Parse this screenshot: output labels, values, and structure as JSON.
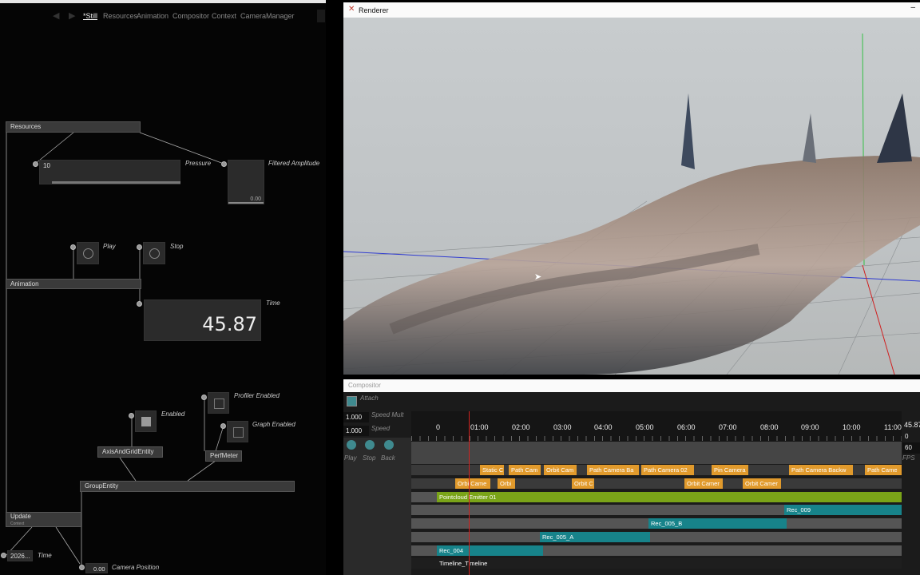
{
  "editor": {
    "tabs": [
      "*Still",
      "Resources",
      "Animation",
      "Compositor",
      "Context",
      "CameraManager"
    ],
    "nodes": {
      "resources": "Resources",
      "animation": "Animation",
      "axis": "AxisAndGridEntity",
      "perfmeter": "PerfMeter",
      "group": "GroupEntity",
      "update": "Update",
      "update_sub": "Context"
    },
    "pressure": {
      "value": "10",
      "label": "Pressure"
    },
    "filtered": {
      "value": "0.00",
      "label": "Filtered Amplitude"
    },
    "play_label": "Play",
    "stop_label": "Stop",
    "time": {
      "value": "45.87",
      "label": "Time"
    },
    "enabled_label": "Enabled",
    "profiler_label": "Profiler Enabled",
    "graph_label": "Graph Enabled",
    "update_time": {
      "value": "2026...",
      "label": "Time"
    },
    "camera_position": {
      "value": "0.00",
      "label": "Camera Position"
    }
  },
  "renderer": {
    "title": "Renderer",
    "minimize": "–"
  },
  "compositor": {
    "title": "Compositor",
    "attach_label": "Attach",
    "speed_mult": {
      "value": "1.000",
      "label": "Speed Mult"
    },
    "speed": {
      "value": "1.000",
      "label": "Speed"
    },
    "buttons": [
      "Play",
      "Stop",
      "Back"
    ],
    "ticks": [
      "0",
      "01:00",
      "02:00",
      "03:00",
      "04:00",
      "05:00",
      "06:00",
      "07:00",
      "08:00",
      "09:00",
      "10:00",
      "11:00"
    ],
    "time_readout": "45.87",
    "frame_readout": "0",
    "fps_value": "60",
    "fps_label": "FPS",
    "clips": {
      "row1": [
        "Static C",
        "Path Cam",
        "Orbit Cam",
        "Path Camera Ba",
        "Path Camera 02",
        "Pin Camera",
        "Path Camera Backw",
        "Path Came"
      ],
      "row2": [
        "Orbi Came",
        "Orbi",
        "Orbit C",
        "Orbit Camer",
        "Orbit Camer"
      ],
      "pointcloud": "Pointcloud Emitter 01",
      "rec009": "Rec_009",
      "rec005b": "Rec_005_B",
      "rec005a": "Rec_005_A",
      "rec004": "Rec_004",
      "timeline": "Timeline_Timeline"
    },
    "colors": {
      "orange": "#e19a2c",
      "green": "#7aa418",
      "teal": "#17838a",
      "playhead": "#d0221f"
    }
  }
}
